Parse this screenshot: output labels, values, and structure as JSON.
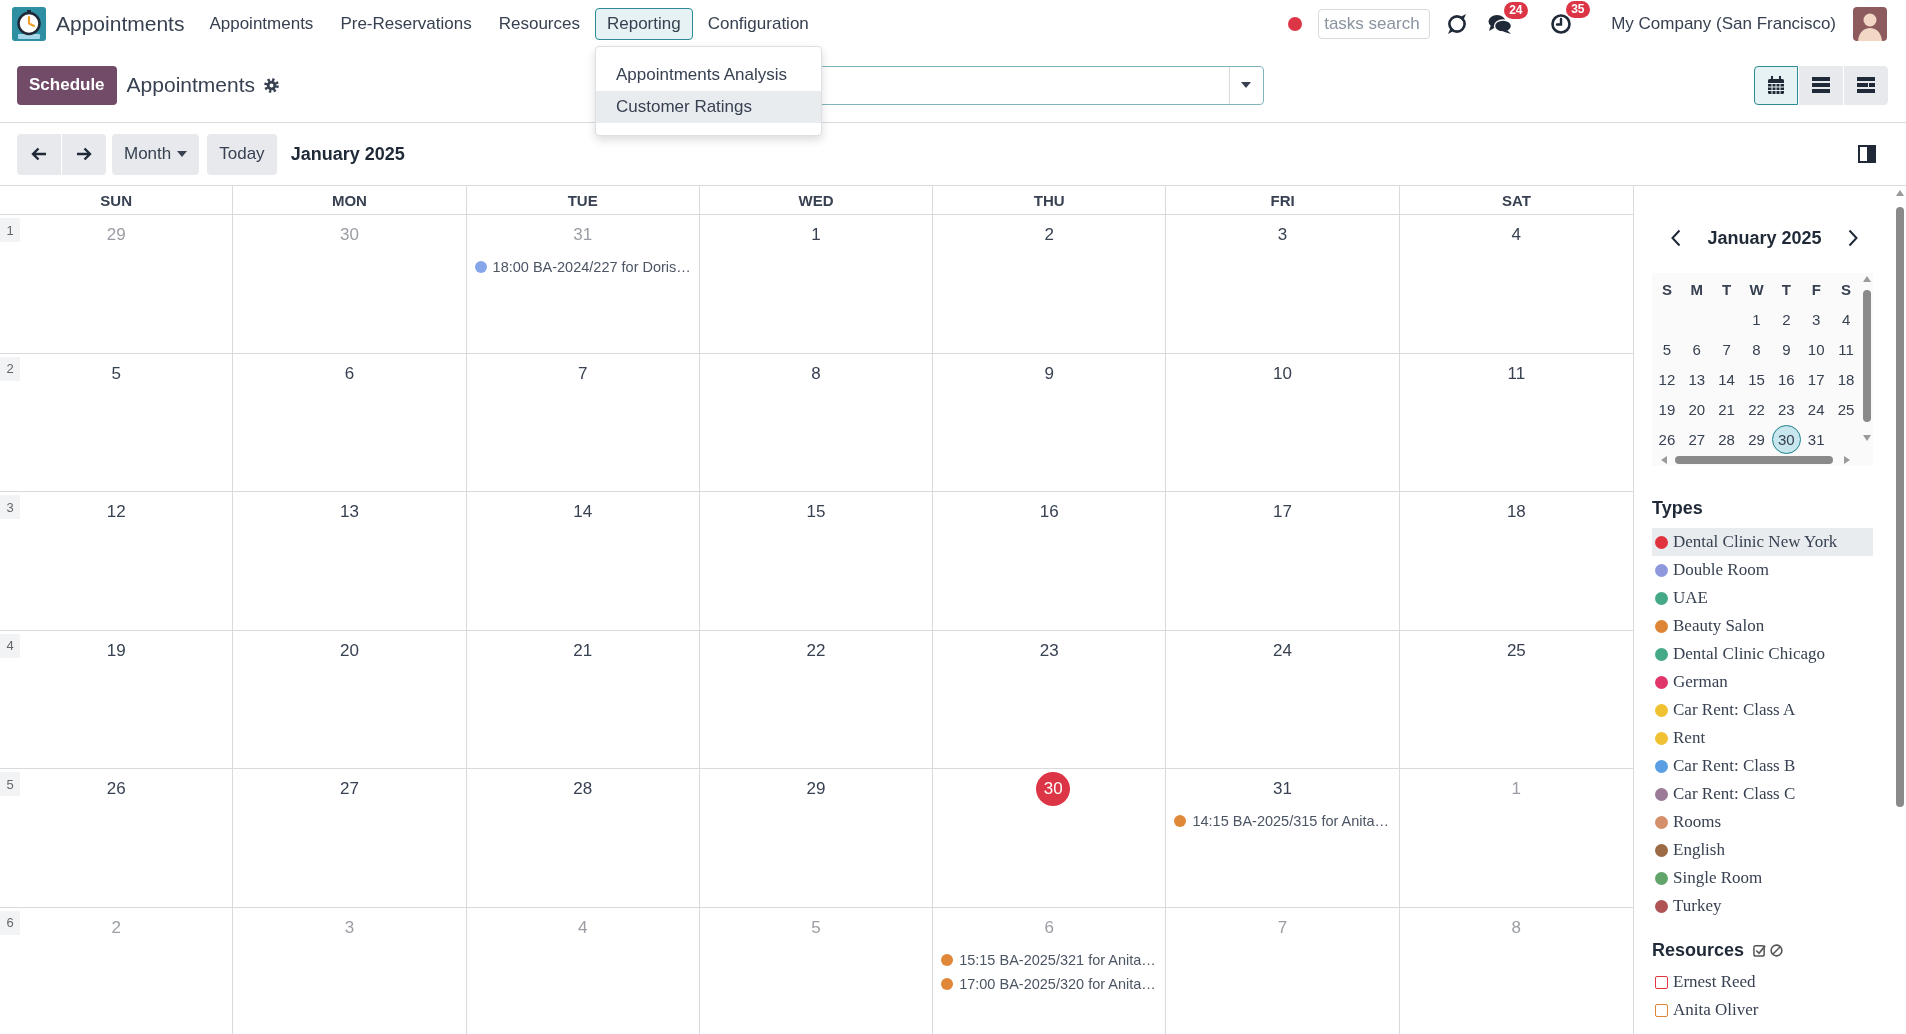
{
  "navbar": {
    "app_name": "Appointments",
    "menu": [
      {
        "label": "Appointments",
        "selected": false
      },
      {
        "label": "Pre-Reservations",
        "selected": false
      },
      {
        "label": "Resources",
        "selected": false
      },
      {
        "label": "Reporting",
        "selected": true
      },
      {
        "label": "Configuration",
        "selected": false
      }
    ],
    "tasks_search": {
      "placeholder": "tasks search"
    },
    "message_count": "24",
    "activity_count": "35",
    "company": "My Company (San Francisco)"
  },
  "reporting_menu": [
    {
      "label": "Appointments Analysis",
      "highlighted": false
    },
    {
      "label": "Customer Ratings",
      "highlighted": true
    }
  ],
  "control_panel": {
    "primary_button": "Schedule",
    "title": "Appointments",
    "views": [
      {
        "kind": "calendar",
        "selected": true
      },
      {
        "kind": "list",
        "selected": false
      },
      {
        "kind": "gantt",
        "selected": false
      }
    ]
  },
  "calendar_toolbar": {
    "scale": "Month",
    "today_button": "Today",
    "period": "January 2025"
  },
  "calendar": {
    "weekdays": [
      "SUN",
      "MON",
      "TUE",
      "WED",
      "THU",
      "FRI",
      "SAT"
    ],
    "weeks": [
      {
        "number": "1",
        "days": [
          {
            "day": "29",
            "in_month": false,
            "today": false
          },
          {
            "day": "30",
            "in_month": false,
            "today": false
          },
          {
            "day": "31",
            "in_month": false,
            "today": false,
            "events": [
              {
                "label": "18:00 BA-2024/227 for Doris…",
                "color": "#86a6ea"
              }
            ]
          },
          {
            "day": "1",
            "in_month": true,
            "today": false
          },
          {
            "day": "2",
            "in_month": true,
            "today": false
          },
          {
            "day": "3",
            "in_month": true,
            "today": false
          },
          {
            "day": "4",
            "in_month": true,
            "today": false
          }
        ]
      },
      {
        "number": "2",
        "days": [
          {
            "day": "5",
            "in_month": true,
            "today": false
          },
          {
            "day": "6",
            "in_month": true,
            "today": false
          },
          {
            "day": "7",
            "in_month": true,
            "today": false
          },
          {
            "day": "8",
            "in_month": true,
            "today": false
          },
          {
            "day": "9",
            "in_month": true,
            "today": false
          },
          {
            "day": "10",
            "in_month": true,
            "today": false
          },
          {
            "day": "11",
            "in_month": true,
            "today": false
          }
        ]
      },
      {
        "number": "3",
        "days": [
          {
            "day": "12",
            "in_month": true,
            "today": false
          },
          {
            "day": "13",
            "in_month": true,
            "today": false
          },
          {
            "day": "14",
            "in_month": true,
            "today": false
          },
          {
            "day": "15",
            "in_month": true,
            "today": false
          },
          {
            "day": "16",
            "in_month": true,
            "today": false
          },
          {
            "day": "17",
            "in_month": true,
            "today": false
          },
          {
            "day": "18",
            "in_month": true,
            "today": false
          }
        ]
      },
      {
        "number": "4",
        "days": [
          {
            "day": "19",
            "in_month": true,
            "today": false
          },
          {
            "day": "20",
            "in_month": true,
            "today": false
          },
          {
            "day": "21",
            "in_month": true,
            "today": false
          },
          {
            "day": "22",
            "in_month": true,
            "today": false
          },
          {
            "day": "23",
            "in_month": true,
            "today": false
          },
          {
            "day": "24",
            "in_month": true,
            "today": false
          },
          {
            "day": "25",
            "in_month": true,
            "today": false
          }
        ]
      },
      {
        "number": "5",
        "days": [
          {
            "day": "26",
            "in_month": true,
            "today": false
          },
          {
            "day": "27",
            "in_month": true,
            "today": false
          },
          {
            "day": "28",
            "in_month": true,
            "today": false
          },
          {
            "day": "29",
            "in_month": true,
            "today": false
          },
          {
            "day": "30",
            "in_month": true,
            "today": true
          },
          {
            "day": "31",
            "in_month": true,
            "today": false,
            "events": [
              {
                "label": "14:15 BA-2025/315 for Anita…",
                "color": "#e0883a"
              }
            ]
          },
          {
            "day": "1",
            "in_month": false,
            "today": false
          }
        ]
      },
      {
        "number": "6",
        "days": [
          {
            "day": "2",
            "in_month": false,
            "today": false
          },
          {
            "day": "3",
            "in_month": false,
            "today": false
          },
          {
            "day": "4",
            "in_month": false,
            "today": false
          },
          {
            "day": "5",
            "in_month": false,
            "today": false
          },
          {
            "day": "6",
            "in_month": false,
            "today": false,
            "events": [
              {
                "label": "15:15 BA-2025/321 for Anita…",
                "color": "#e0883a"
              },
              {
                "label": "17:00 BA-2025/320 for Anita…",
                "color": "#e0883a"
              }
            ]
          },
          {
            "day": "7",
            "in_month": false,
            "today": false
          },
          {
            "day": "8",
            "in_month": false,
            "today": false
          }
        ]
      }
    ]
  },
  "sidebar": {
    "mini_calendar": {
      "title": "January 2025",
      "weekdays": [
        "S",
        "M",
        "T",
        "W",
        "T",
        "F",
        "S"
      ],
      "weeks": [
        [
          {
            "day": "1",
            "selected": false
          },
          {
            "day": "2",
            "selected": false
          },
          {
            "day": "3",
            "selected": false
          },
          {
            "day": "4",
            "selected": false
          }
        ],
        [
          {
            "day": "5",
            "selected": false
          },
          {
            "day": "6",
            "selected": false
          },
          {
            "day": "7",
            "selected": false
          },
          {
            "day": "8",
            "selected": false
          },
          {
            "day": "9",
            "selected": false
          },
          {
            "day": "10",
            "selected": false
          },
          {
            "day": "11",
            "selected": false
          }
        ],
        [
          {
            "day": "12",
            "selected": false
          },
          {
            "day": "13",
            "selected": false
          },
          {
            "day": "14",
            "selected": false
          },
          {
            "day": "15",
            "selected": false
          },
          {
            "day": "16",
            "selected": false
          },
          {
            "day": "17",
            "selected": false
          },
          {
            "day": "18",
            "selected": false
          }
        ],
        [
          {
            "day": "19",
            "selected": false
          },
          {
            "day": "20",
            "selected": false
          },
          {
            "day": "21",
            "selected": false
          },
          {
            "day": "22",
            "selected": false
          },
          {
            "day": "23",
            "selected": false
          },
          {
            "day": "24",
            "selected": false
          },
          {
            "day": "25",
            "selected": false
          }
        ],
        [
          {
            "day": "26",
            "selected": false
          },
          {
            "day": "27",
            "selected": false
          },
          {
            "day": "28",
            "selected": false
          },
          {
            "day": "29",
            "selected": false
          },
          {
            "day": "30",
            "selected": true
          },
          {
            "day": "31",
            "selected": false
          }
        ]
      ]
    },
    "types_title": "Types",
    "types": [
      {
        "label": "Dental Clinic New York",
        "color": "#e0333d",
        "highlighted": true
      },
      {
        "label": "Double Room",
        "color": "#8e99dd",
        "highlighted": false
      },
      {
        "label": "UAE",
        "color": "#45a987",
        "highlighted": false
      },
      {
        "label": "Beauty Salon",
        "color": "#de8535",
        "highlighted": false
      },
      {
        "label": "Dental Clinic Chicago",
        "color": "#45a988",
        "highlighted": false
      },
      {
        "label": "German",
        "color": "#e2366b",
        "highlighted": false
      },
      {
        "label": "Car Rent: Class A",
        "color": "#f0c131",
        "highlighted": false
      },
      {
        "label": "Rent",
        "color": "#f0c132",
        "highlighted": false
      },
      {
        "label": "Car Rent: Class B",
        "color": "#5a9fe3",
        "highlighted": false
      },
      {
        "label": "Car Rent: Class C",
        "color": "#9a7a96",
        "highlighted": false
      },
      {
        "label": "Rooms",
        "color": "#d4906a",
        "highlighted": false
      },
      {
        "label": "English",
        "color": "#9c6b45",
        "highlighted": false
      },
      {
        "label": "Single Room",
        "color": "#62a46a",
        "highlighted": false
      },
      {
        "label": "Turkey",
        "color": "#b05355",
        "highlighted": false
      }
    ],
    "resources_title": "Resources",
    "resources": [
      {
        "label": "Ernest Reed",
        "color": "#e0333d",
        "checked": false
      },
      {
        "label": "Anita Oliver",
        "color": "#de8535",
        "checked": false
      }
    ]
  }
}
